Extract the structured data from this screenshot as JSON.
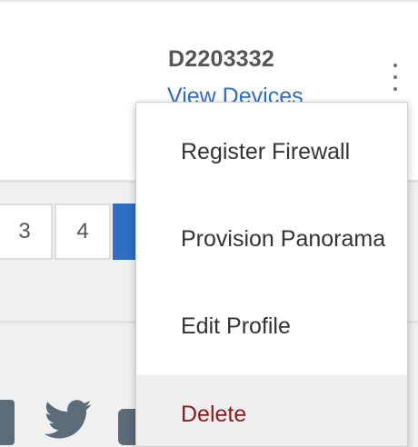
{
  "card": {
    "device_id": "D2203332",
    "view_devices_label": "View Devices"
  },
  "pagination": {
    "pages": [
      "3",
      "4"
    ],
    "active_color": "#2f6fc1"
  },
  "menu": {
    "items": [
      {
        "label": "Register Firewall"
      },
      {
        "label": "Provision Panorama"
      },
      {
        "label": "Edit Profile"
      },
      {
        "label": "Delete"
      }
    ]
  },
  "icons": {
    "kebab": "more-vertical-icon",
    "social": [
      "linkedin-icon",
      "twitter-icon",
      "social-icon"
    ]
  },
  "colors": {
    "link": "#2f6fc1",
    "danger": "#8b1a1a"
  }
}
